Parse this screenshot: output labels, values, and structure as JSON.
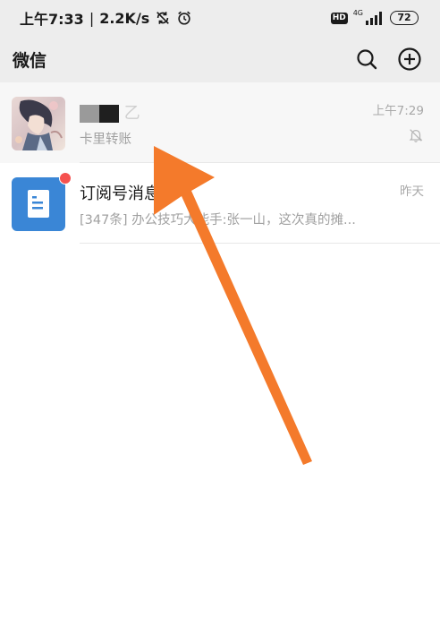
{
  "status_bar": {
    "time": "上午7:33",
    "separator": "|",
    "net_speed": "2.2K/s",
    "icons": [
      "sync-off-icon",
      "alarm-icon",
      "hd-icon",
      "signal-icon"
    ],
    "hd_label": "HD",
    "network_type": "4G",
    "battery": "72"
  },
  "header": {
    "title": "微信",
    "icons": [
      "search-icon",
      "add-circle-icon"
    ]
  },
  "chats": [
    {
      "name_suffix": "乙",
      "preview": "卡里转账",
      "time": "上午7:29",
      "muted": true,
      "pinned": true
    },
    {
      "name": "订阅号消息",
      "preview": "[347条] 办公技巧大能手:张一山，这次真的摊...",
      "time": "昨天",
      "unread_dot": true,
      "pinned": false
    }
  ],
  "colors": {
    "header_bg": "#ededed",
    "arrow": "#f47a2b",
    "subscription_avatar": "#3a86d6",
    "unread_dot": "#f5514f"
  }
}
